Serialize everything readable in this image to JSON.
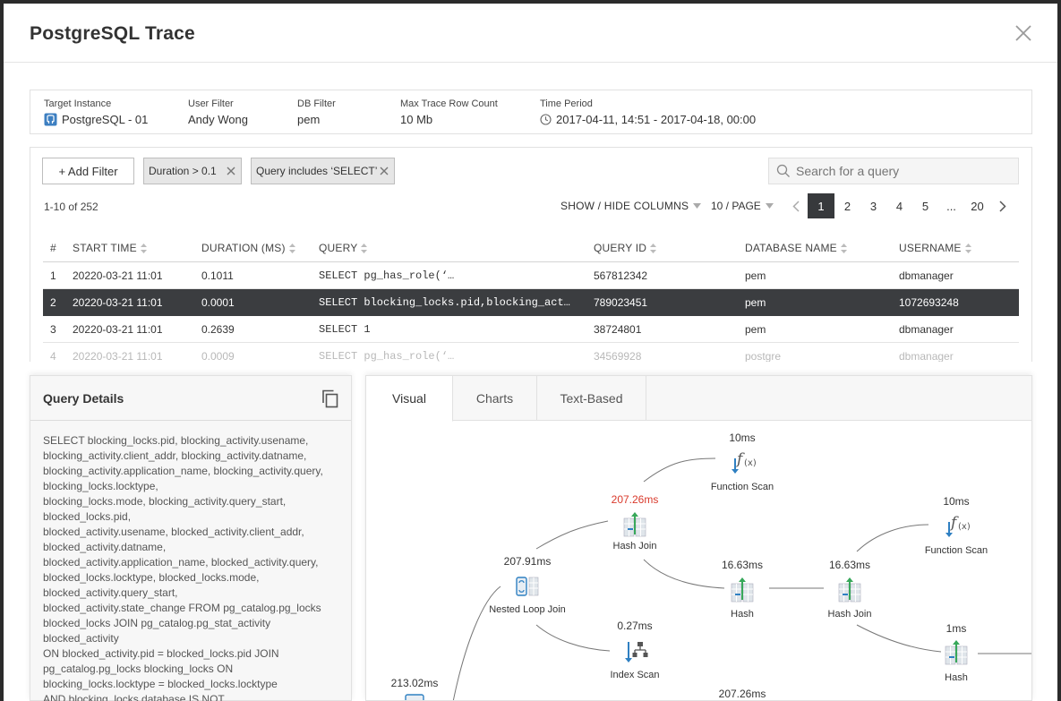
{
  "header": {
    "title": "PostgreSQL Trace"
  },
  "info": {
    "target_instance": {
      "label": "Target Instance",
      "value": "PostgreSQL - 01"
    },
    "user_filter": {
      "label": "User Filter",
      "value": "Andy Wong"
    },
    "db_filter": {
      "label": "DB Filter",
      "value": "pem"
    },
    "max_rows": {
      "label": "Max Trace Row Count",
      "value": "10 Mb"
    },
    "time_period": {
      "label": "Time Period",
      "value": "2017-04-11, 14:51 - 2017-04-18, 00:00"
    }
  },
  "filters": {
    "add_label": "+ Add Filter",
    "chips": [
      "Duration > 0.1",
      "Query includes ‘SELECT’"
    ],
    "search_placeholder": "Search for a query"
  },
  "table_meta": {
    "count": "1-10 of 252",
    "show_hide": "SHOW / HIDE COLUMNS",
    "per_page": "10 / PAGE",
    "pages": [
      "1",
      "2",
      "3",
      "4",
      "5",
      "...",
      "20"
    ],
    "active_page": "1"
  },
  "columns": [
    "#",
    "START TIME",
    "DURATION (MS)",
    "QUERY",
    "QUERY ID",
    "DATABASE NAME",
    "USERNAME"
  ],
  "rows": [
    [
      "1",
      "20220-03-21 11:01",
      "0.1011",
      "SELECT pg_has_role(‘…",
      "567812342",
      "pem",
      "dbmanager"
    ],
    [
      "2",
      "20220-03-21 11:01",
      "0.0001",
      "SELECT blocking_locks.pid,blocking_act…",
      "789023451",
      "pem",
      "1072693248"
    ],
    [
      "3",
      "20220-03-21 11:01",
      "0.2639",
      "SELECT 1",
      "38724801",
      "pem",
      "dbmanager"
    ],
    [
      "4",
      "20220-03-21 11:01",
      "0.0009",
      "SELECT pg_has_role(‘…",
      "34569928",
      "postgre",
      "dbmanager"
    ]
  ],
  "query_details": {
    "title": "Query Details",
    "lines": [
      "SELECT blocking_locks.pid, blocking_activity.usename,",
      "blocking_activity.client_addr, blocking_activity.datname,",
      "blocking_activity.application_name, blocking_activity.query,",
      "blocking_locks.locktype,",
      "blocking_locks.mode, blocking_activity.query_start,",
      "blocked_locks.pid,",
      "blocked_activity.usename, blocked_activity.client_addr,",
      "blocked_activity.datname,",
      "blocked_activity.application_name, blocked_activity.query,",
      "blocked_locks.locktype, blocked_locks.mode,",
      "blocked_activity.query_start,",
      "blocked_activity.state_change FROM pg_catalog.pg_locks",
      "blocked_locks JOIN pg_catalog.pg_stat_activity",
      "blocked_activity",
      "ON blocked_activity.pid = blocked_locks.pid JOIN",
      "pg_catalog.pg_locks blocking_locks ON",
      "blocking_locks.locktype = blocked_locks.locktype",
      "AND blocking_locks.database IS NOT"
    ]
  },
  "plan_tabs": [
    "Visual",
    "Charts",
    "Text-Based"
  ],
  "plan_nodes": [
    {
      "name": "Function Scan",
      "time": "10ms",
      "icon": "function-icon"
    },
    {
      "name": "Hash Join",
      "time": "207.26ms",
      "icon": "hash-join-icon",
      "highlight": "#d9392b"
    },
    {
      "name": "Function Scan",
      "time": "10ms",
      "icon": "function-icon"
    },
    {
      "name": "Nested Loop Join",
      "time": "207.91ms",
      "icon": "nested-loop-icon"
    },
    {
      "name": "Hash",
      "time": "16.63ms",
      "icon": "hash-icon"
    },
    {
      "name": "Hash Join",
      "time": "16.63ms",
      "icon": "hash-join-icon"
    },
    {
      "name": "Index Scan",
      "time": "0.27ms",
      "icon": "index-scan-icon"
    },
    {
      "name": "Hash",
      "time": "1ms",
      "icon": "hash-icon"
    },
    {
      "name": "",
      "time": "213.02ms",
      "icon": "scan-icon"
    },
    {
      "name": "",
      "time": "207.26ms",
      "icon": ""
    }
  ]
}
